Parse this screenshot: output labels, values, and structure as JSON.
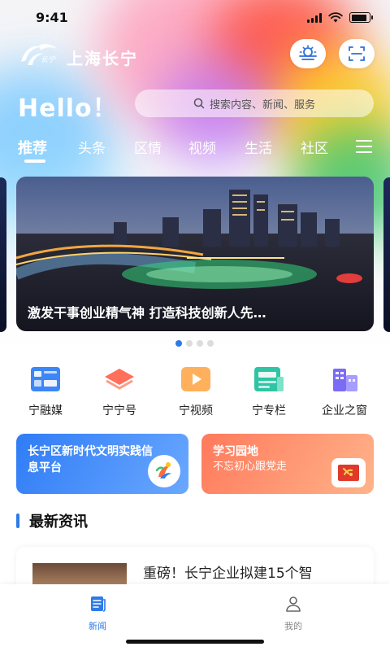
{
  "status_bar": {
    "time": "9:41",
    "battery_level": 0.9
  },
  "header": {
    "title": "上海长宁",
    "logo_label": "长宁"
  },
  "greeting": "Hello！",
  "search": {
    "placeholder": "搜索内容、新闻、服务"
  },
  "tabs": [
    {
      "label": "推荐",
      "active": true
    },
    {
      "label": "头条"
    },
    {
      "label": "区情"
    },
    {
      "label": "视频"
    },
    {
      "label": "生活"
    },
    {
      "label": "社区"
    }
  ],
  "banner": {
    "caption": "激发干事创业精气神 打造科技创新人先…",
    "page_count": 4,
    "current_page": 1
  },
  "shortcuts": [
    {
      "label": "宁融媒",
      "icon": "grid-card-icon",
      "color": "#3d86f5"
    },
    {
      "label": "宁宁号",
      "icon": "layers-icon",
      "color": "#ff6f5a"
    },
    {
      "label": "宁视频",
      "icon": "video-play-icon",
      "color": "#ff9f43"
    },
    {
      "label": "宁专栏",
      "icon": "column-doc-icon",
      "color": "#2ec4a4"
    },
    {
      "label": "企业之窗",
      "icon": "buildings-icon",
      "color": "#7b6cf6"
    }
  ],
  "cards": [
    {
      "title": "长宁区新时代文明实践信息平台",
      "subtitle": "",
      "color": "#2f7cf6"
    },
    {
      "title": "学习园地",
      "subtitle": "不忘初心跟党走",
      "color": "#ff7a5c"
    }
  ],
  "section": {
    "title": "最新资讯"
  },
  "news": [
    {
      "title": "重磅！长宁企业拟建15个智"
    }
  ],
  "tabbar": [
    {
      "label": "新闻",
      "icon": "news-icon",
      "active": true
    },
    {
      "label": "我的",
      "icon": "profile-icon",
      "active": false
    }
  ],
  "colors": {
    "accent": "#2d7be8",
    "text": "#222222"
  }
}
